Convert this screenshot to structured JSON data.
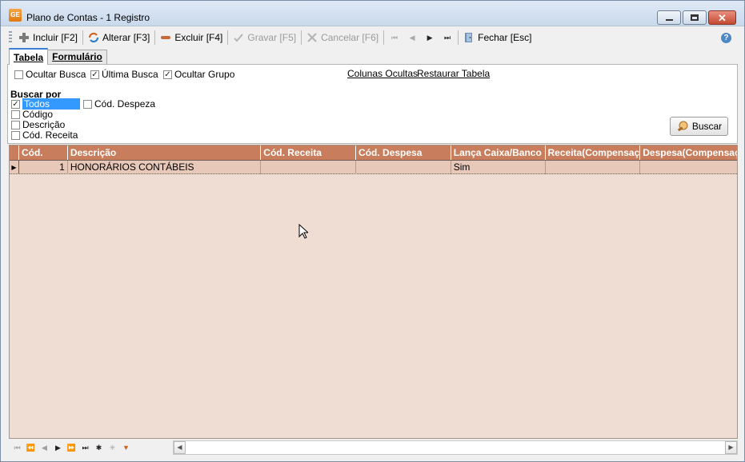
{
  "window": {
    "app_icon_text": "GE",
    "title": "Plano de Contas - 1 Registro",
    "close_glyph": "✕"
  },
  "toolbar": {
    "incluir": "Incluir [F2]",
    "alterar": "Alterar [F3]",
    "excluir": "Excluir [F4]",
    "gravar": "Gravar [F5]",
    "cancelar": "Cancelar [F6]",
    "fechar": "Fechar [Esc]",
    "help": "?"
  },
  "tabs": [
    {
      "label": "Tabela",
      "active": true
    },
    {
      "label": "Formulário",
      "active": false
    }
  ],
  "options": {
    "ocultar_busca": {
      "label": "Ocultar Busca",
      "checked": false
    },
    "ultima_busca": {
      "label": "Última Busca",
      "checked": true
    },
    "ocultar_grupo": {
      "label": "Ocultar Grupo",
      "checked": true
    },
    "colunas_ocultas": "Colunas Ocultas",
    "restaurar_tabela": "Restaurar Tabela"
  },
  "buscar_por": {
    "label": "Buscar por",
    "todos": {
      "label": "Todos",
      "checked": true
    },
    "cod_despeza": {
      "label": "Cód. Despeza",
      "checked": false
    },
    "codigo": {
      "label": "Código",
      "checked": false
    },
    "descricao": {
      "label": "Descrição",
      "checked": false
    },
    "cod_receita": {
      "label": "Cód. Receita",
      "checked": false
    },
    "button": "Buscar"
  },
  "grid": {
    "columns": [
      "Cód.",
      "Descrição",
      "Cód. Receita",
      "Cód. Despesa",
      "Lança Caixa/Banco",
      "Receita(Compensaç",
      "Despesa(Compensaç"
    ],
    "rows": [
      {
        "cod": "1",
        "descricao": "HONORÁRIOS CONTÁBEIS",
        "cod_receita": "",
        "cod_despesa": "",
        "lanca_caixa": "Sim",
        "receita_comp": "",
        "despesa_comp": ""
      }
    ]
  },
  "colors": {
    "header_bg": "#c87e5c",
    "grid_bg": "#efdcd2",
    "selected_row": "#e8c8b8",
    "selection_blue": "#3399ff"
  }
}
